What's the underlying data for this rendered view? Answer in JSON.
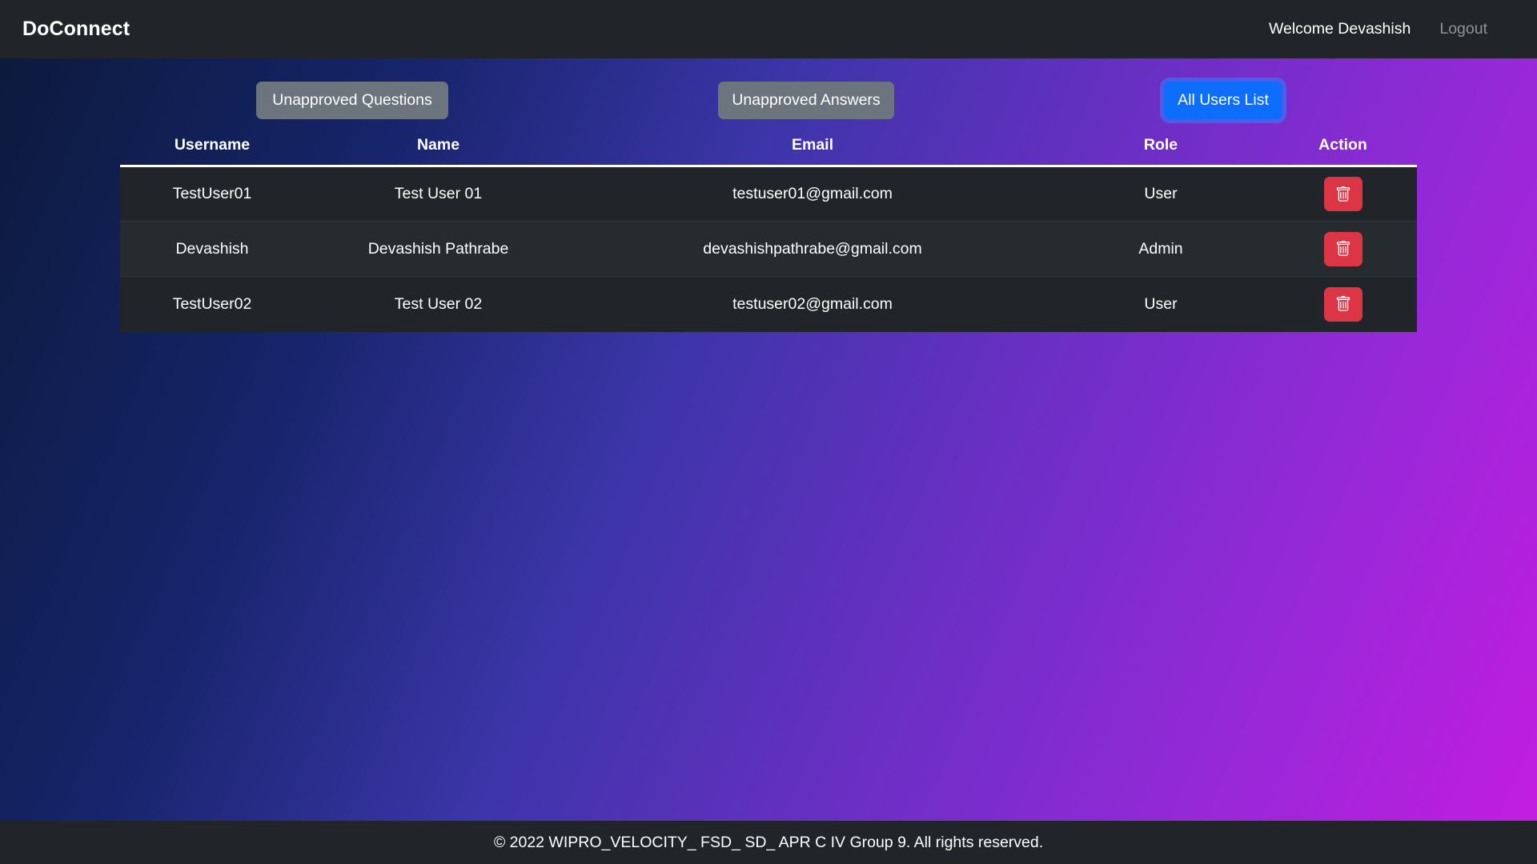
{
  "navbar": {
    "brand": "DoConnect",
    "welcome": "Welcome Devashish",
    "logout": "Logout"
  },
  "toolbar": {
    "unapproved_questions_label": "Unapproved Questions",
    "unapproved_answers_label": "Unapproved Answers",
    "all_users_label": "All Users List",
    "active_button": "All Users List"
  },
  "table": {
    "columns": [
      "Username",
      "Name",
      "Email",
      "Role",
      "Action"
    ],
    "rows": [
      {
        "username": "TestUser01",
        "name": "Test User 01",
        "email": "testuser01@gmail.com",
        "role": "User"
      },
      {
        "username": "Devashish",
        "name": "Devashish Pathrabe",
        "email": "devashishpathrabe@gmail.com",
        "role": "Admin"
      },
      {
        "username": "TestUser02",
        "name": "Test User 02",
        "email": "testuser02@gmail.com",
        "role": "User"
      }
    ],
    "delete_icon": "trash-icon"
  },
  "footer": {
    "text": "© 2022 WIPRO_VELOCITY_ FSD_ SD_ APR C IV Group 9. All rights reserved."
  },
  "colors": {
    "navbar_bg": "#212529",
    "footer_bg": "#212529",
    "primary": "#0d6efd",
    "secondary": "#6c757d",
    "danger": "#dc3545",
    "table_row_bg": "#212529",
    "gradient_start": "#0c1a3d",
    "gradient_end": "#c41ce0",
    "muted_text": "#8f9398"
  }
}
